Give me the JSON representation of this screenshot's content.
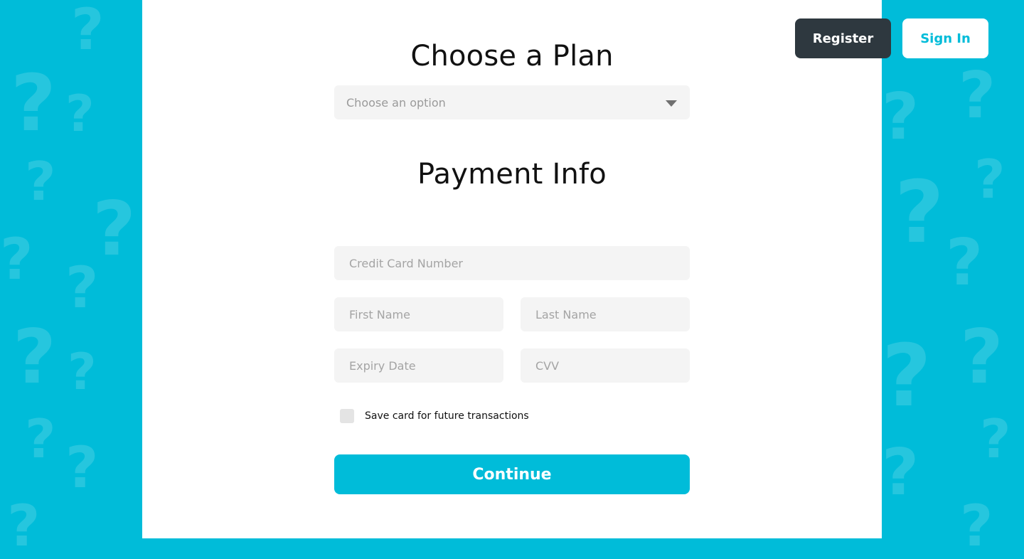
{
  "plan": {
    "title": "Choose a Plan",
    "select_placeholder": "Choose an option"
  },
  "payment": {
    "title": "Payment Info",
    "credit_card_placeholder": "Credit Card Number",
    "first_name_placeholder": "First Name",
    "last_name_placeholder": "Last Name",
    "expiry_placeholder": "Expiry Date",
    "cvv_placeholder": "CVV",
    "save_card_label": "Save card for future transactions",
    "continue_label": "Continue"
  },
  "header": {
    "register_label": "Register",
    "signin_label": "Sign In"
  },
  "colors": {
    "accent": "#00BCD9",
    "dark_button": "#2E383F",
    "field_bg": "#F4F4F4"
  },
  "icons": {
    "background_pattern": "question-mark-icon",
    "select_caret": "caret-down-icon"
  }
}
